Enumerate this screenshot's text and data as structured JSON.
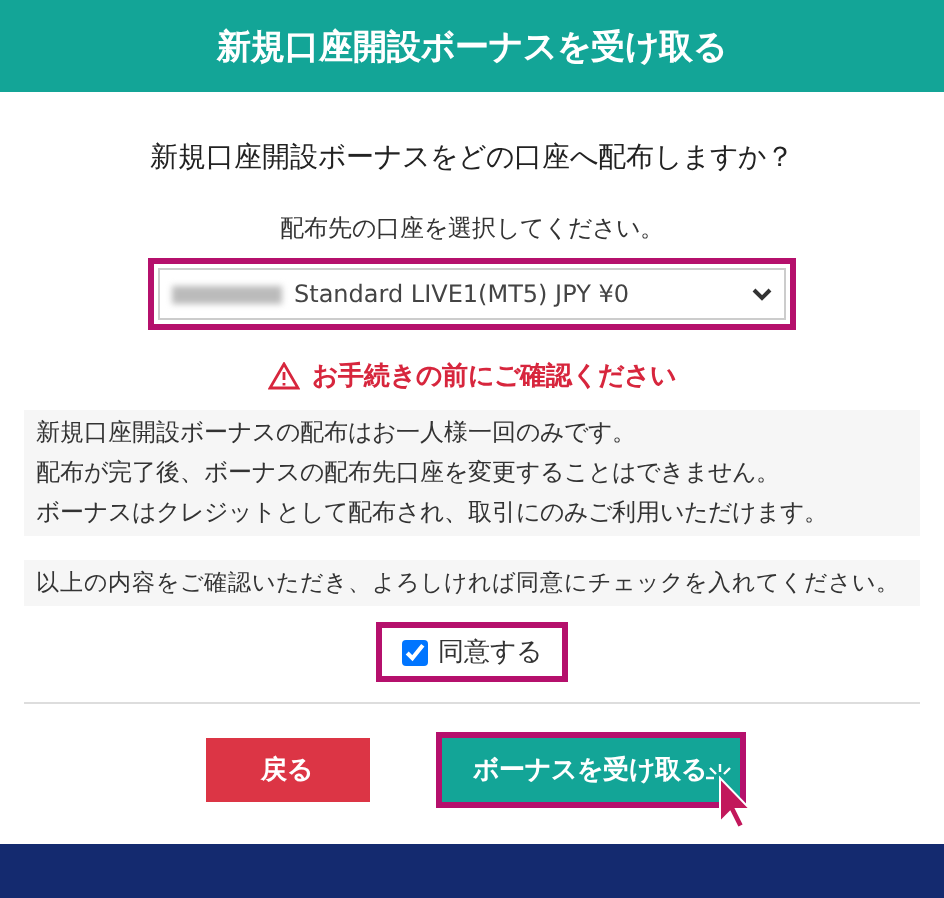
{
  "header": {
    "title": "新規口座開設ボーナスを受け取る"
  },
  "question": "新規口座開設ボーナスをどの口座へ配布しますか？",
  "account_select": {
    "label": "配布先の口座を選択してください。",
    "value": "Standard LIVE1(MT5) JPY ¥0",
    "highlighted": true
  },
  "warning": "お手続きの前にご確認ください",
  "notes": [
    "新規口座開設ボーナスの配布はお一人様一回のみです。",
    "配布が完了後、ボーナスの配布先口座を変更することはできません。",
    "ボーナスはクレジットとして配布され、取引にのみご利用いただけます。"
  ],
  "confirm_text": "以上の内容をご確認いただき、よろしければ同意にチェックを入れてください。",
  "agree": {
    "label": "同意する",
    "checked": true,
    "highlighted": true
  },
  "buttons": [
    {
      "label": "戻る",
      "kind": "back",
      "highlighted": false
    },
    {
      "label": "ボーナスを受け取る",
      "kind": "primary",
      "highlighted": true
    }
  ]
}
